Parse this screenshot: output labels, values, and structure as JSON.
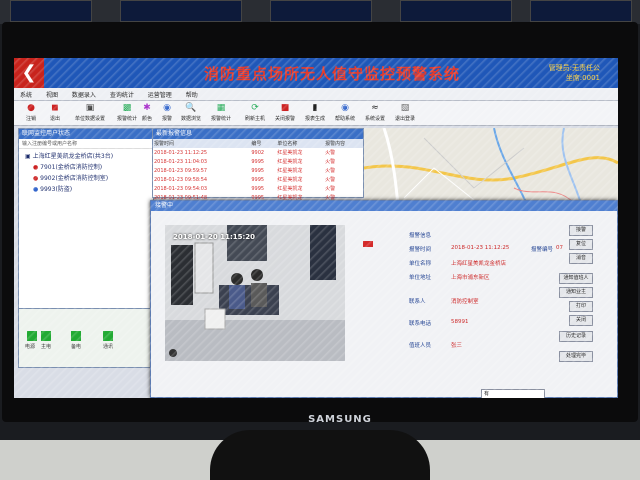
{
  "app": {
    "title": "消防重点场所无人值守监控预警系统",
    "user_line1": "管理员:无责任公",
    "user_line2": "坐席:0001"
  },
  "menu": [
    "系统",
    "视图",
    "数据录入",
    "查询统计",
    "运营管理",
    "帮助"
  ],
  "toolbar": [
    {
      "label": "注销",
      "icon": "logout-icon"
    },
    {
      "label": "退出",
      "icon": "exit-icon"
    },
    {
      "label": "单位数据设置",
      "icon": "settings-icon"
    },
    {
      "label": "报警统计",
      "icon": "chart-icon"
    },
    {
      "label": "颜色",
      "icon": "palette-icon"
    },
    {
      "label": "报警",
      "icon": "alarm-icon"
    },
    {
      "label": "数据浏览",
      "icon": "browse-icon"
    },
    {
      "label": "报警统计",
      "icon": "stats-icon"
    },
    {
      "label": "刷新主机",
      "icon": "refresh-icon"
    },
    {
      "label": "关闭报警",
      "icon": "close-alarm-icon"
    },
    {
      "label": "报表生成",
      "icon": "report-icon"
    },
    {
      "label": "帮助系统",
      "icon": "help-icon"
    },
    {
      "label": "系统设置",
      "icon": "signal-icon"
    },
    {
      "label": "退出登录",
      "icon": "lock-icon"
    }
  ],
  "left_panel": {
    "title": "联网监控用户状态",
    "subtitle": "输入注册编号或用户名称",
    "tree_root": "上海红星美凯龙金桥店(共3台)",
    "tree_items": [
      "7901(金桥店消防控制)",
      "9902(金桥店消防控制室)",
      "9993(防盗)"
    ]
  },
  "status_box": {
    "signals": [
      "电源",
      "主电",
      "备电",
      "通讯"
    ]
  },
  "alarm_list": {
    "title": "最新报警信息",
    "columns": [
      "报警时间",
      "编号",
      "单位名称",
      "报警内容"
    ],
    "rows": [
      [
        "2018-01-23 11:12:25",
        "9902",
        "红星美凯龙",
        "火警"
      ],
      [
        "2018-01-23 11:04:03",
        "9995",
        "红星美凯龙",
        "火警"
      ],
      [
        "2018-01-23 09:59:57",
        "9995",
        "红星美凯龙",
        "火警"
      ],
      [
        "2018-01-23 09:58:54",
        "9995",
        "红星美凯龙",
        "火警"
      ],
      [
        "2018-01-23 09:54:03",
        "9995",
        "红星美凯龙",
        "火警"
      ],
      [
        "2018-01-23 09:51:48",
        "9995",
        "红星美凯龙",
        "火警"
      ]
    ]
  },
  "dialog": {
    "title": "接警中",
    "timestamp": "2018-01-20 11:15:20",
    "fields": [
      {
        "label": "报警信息",
        "value": ""
      },
      {
        "label": "报警时间",
        "value": "2018-01-23 11:12:25"
      },
      {
        "label": "报警编号",
        "value": "07"
      },
      {
        "label": "单位名称",
        "value": "上海红星美凯龙金桥店"
      },
      {
        "label": "单位地址",
        "value": "上海市浦东新区"
      },
      {
        "label": "联系人",
        "value": "消防控制室"
      },
      {
        "label": "联系电话",
        "value": "58991"
      },
      {
        "label": "值班人员",
        "value": "张三"
      }
    ],
    "buttons": [
      "接警",
      "复位",
      "消音",
      "通知值班人",
      "通知业主",
      "打印",
      "关闭",
      "历史记录",
      "处理完毕"
    ],
    "select_value": "有"
  },
  "monitor": {
    "brand": "SAMSUNG"
  }
}
